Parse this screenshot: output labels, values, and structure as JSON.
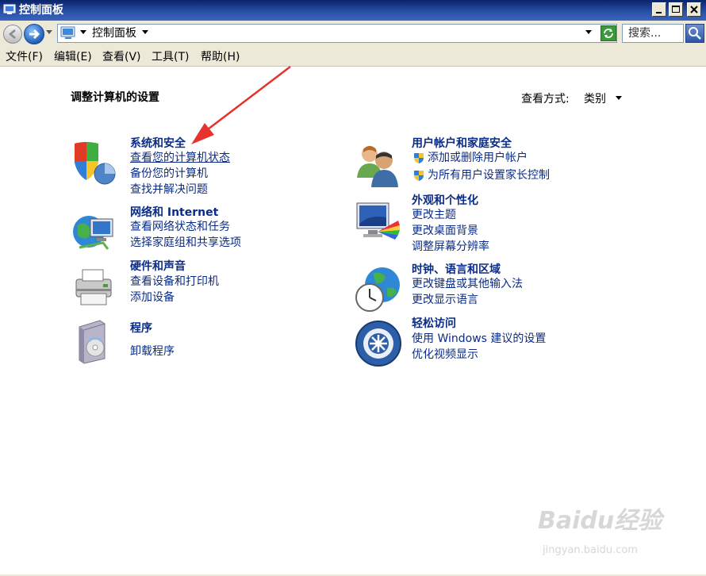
{
  "window": {
    "title": "控制面板"
  },
  "address": {
    "location": "控制面板",
    "search_placeholder": "搜索..."
  },
  "menu": [
    "文件(F)",
    "编辑(E)",
    "查看(V)",
    "工具(T)",
    "帮助(H)"
  ],
  "main": {
    "heading": "调整计算机的设置",
    "view_by_label": "查看方式:",
    "view_by_value": "类别"
  },
  "categories": {
    "system_security": {
      "title": "系统和安全",
      "links": [
        "查看您的计算机状态",
        "备份您的计算机",
        "查找并解决问题"
      ]
    },
    "network": {
      "title": "网络和 Internet",
      "links": [
        "查看网络状态和任务",
        "选择家庭组和共享选项"
      ]
    },
    "hardware": {
      "title": "硬件和声音",
      "links": [
        "查看设备和打印机",
        "添加设备"
      ]
    },
    "programs": {
      "title": "程序",
      "links": [
        "卸载程序"
      ]
    },
    "user_accounts": {
      "title": "用户帐户和家庭安全",
      "links": [
        "添加或删除用户帐户",
        "为所有用户设置家长控制"
      ]
    },
    "appearance": {
      "title": "外观和个性化",
      "links": [
        "更改主题",
        "更改桌面背景",
        "调整屏幕分辨率"
      ]
    },
    "clock": {
      "title": "时钟、语言和区域",
      "links": [
        "更改键盘或其他输入法",
        "更改显示语言"
      ]
    },
    "ease": {
      "title": "轻松访问",
      "links": [
        "使用 Windows 建议的设置",
        "优化视频显示"
      ]
    }
  },
  "watermark": {
    "brand": "Baidu经验",
    "url": "jingyan.baidu.com"
  },
  "colors": {
    "link": "#0b2c86",
    "annotation_arrow": "#e8322d",
    "titlebar": "#0a246a"
  }
}
